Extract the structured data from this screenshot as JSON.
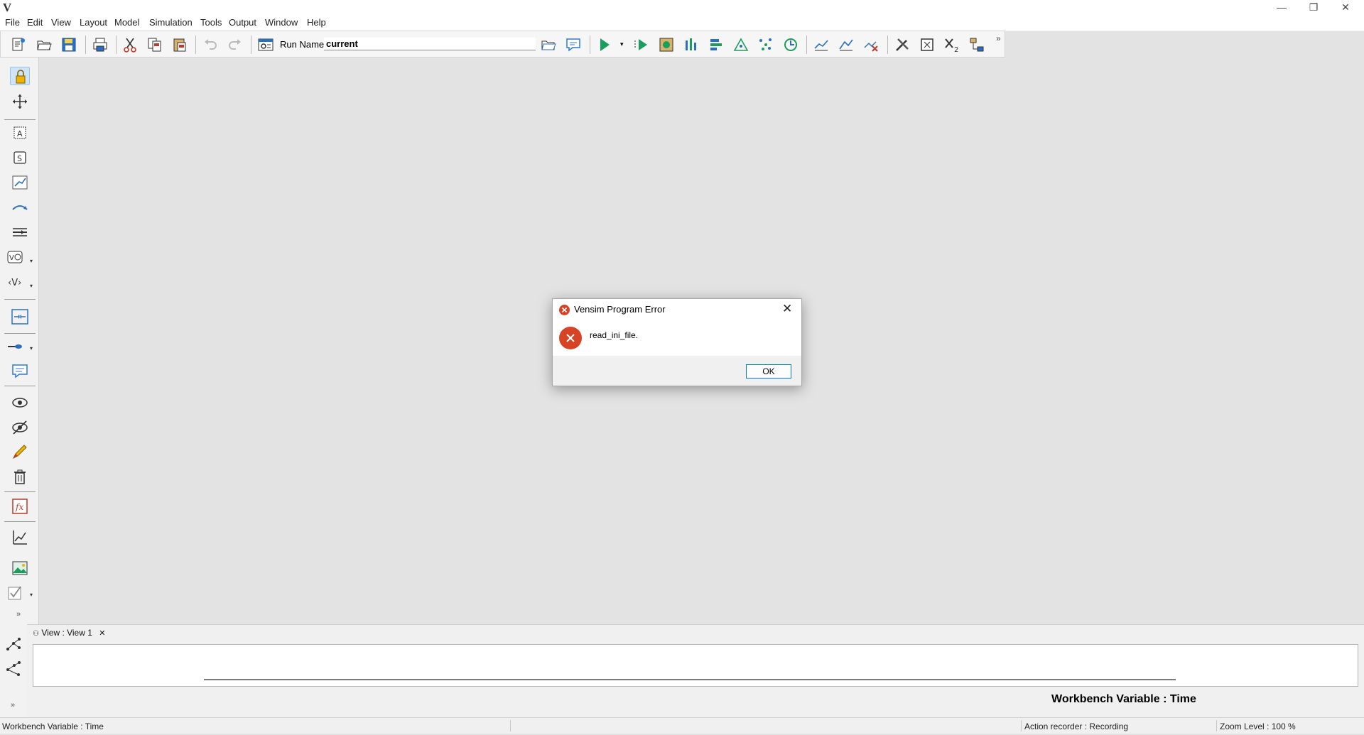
{
  "window": {
    "logo": "V",
    "minimize": "—",
    "restore": "❐",
    "close": "✕"
  },
  "menu": [
    "File",
    "Edit",
    "View",
    "Layout",
    "Model",
    "Simulation",
    "Tools",
    "Output",
    "Window",
    "Help"
  ],
  "toolbar": {
    "run_name_label": "Run Name:",
    "run_name_value": "current",
    "overflow": "»"
  },
  "palette": {
    "more": "»",
    "dropdown": "▾"
  },
  "bottom": {
    "view_tab_label": "View : View 1",
    "view_tab_close": "✕",
    "workbench_variable": "Workbench Variable : Time",
    "more": "»"
  },
  "status": {
    "workbench": "Workbench Variable : Time",
    "recorder": "Action recorder : Recording",
    "zoom": "Zoom Level : 100 %"
  },
  "dialog": {
    "title": "Vensim Program Error",
    "message": "read_ini_file.",
    "ok_label": "OK",
    "close_glyph": "✕",
    "icon_glyph": "✕",
    "icon_color": "#d74425"
  },
  "colors": {
    "accent": "#0078d7",
    "error": "#d74425",
    "run_green": "#1a9e5c"
  }
}
